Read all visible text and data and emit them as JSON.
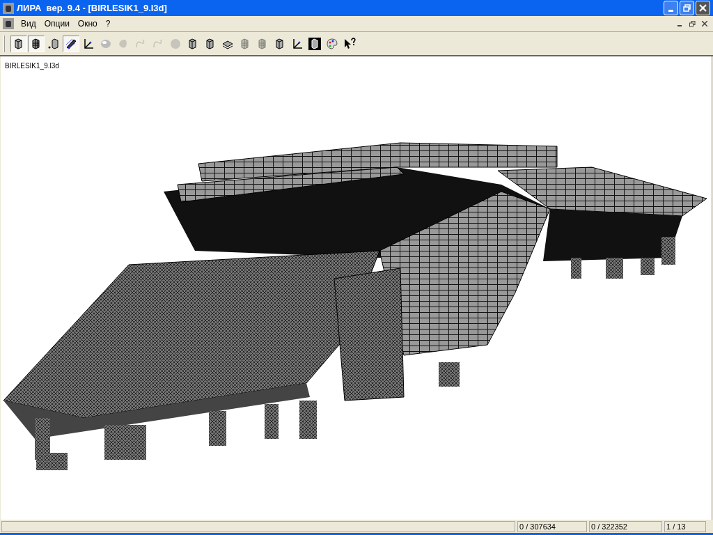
{
  "window": {
    "title": "ЛИРА  вер. 9.4 - [BIRLESIK1_9.l3d]"
  },
  "menu": [
    "Вид",
    "Опции",
    "Окно",
    "?"
  ],
  "toolbar": [
    {
      "kind": "cube",
      "pressed": true,
      "disabled": false
    },
    {
      "kind": "mesh",
      "pressed": true,
      "disabled": false
    },
    {
      "kind": "nodes",
      "pressed": false,
      "disabled": false
    },
    {
      "kind": "beam",
      "pressed": true,
      "disabled": false
    },
    {
      "kind": "axes",
      "pressed": false,
      "disabled": false
    },
    {
      "kind": "sphere",
      "pressed": false,
      "disabled": false
    },
    {
      "kind": "blob",
      "pressed": false,
      "disabled": true
    },
    {
      "kind": "curve",
      "pressed": false,
      "disabled": true
    },
    {
      "kind": "curve",
      "pressed": false,
      "disabled": true
    },
    {
      "kind": "disc",
      "pressed": false,
      "disabled": true
    },
    {
      "kind": "cube",
      "pressed": false,
      "disabled": false
    },
    {
      "kind": "cube",
      "pressed": false,
      "disabled": false
    },
    {
      "kind": "layers",
      "pressed": false,
      "disabled": false
    },
    {
      "kind": "mesh",
      "pressed": false,
      "disabled": true
    },
    {
      "kind": "mesh",
      "pressed": false,
      "disabled": true
    },
    {
      "kind": "cube",
      "pressed": false,
      "disabled": false
    },
    {
      "kind": "axes",
      "pressed": false,
      "disabled": false
    },
    {
      "kind": "solid",
      "pressed": false,
      "disabled": false
    },
    {
      "kind": "palette",
      "pressed": false,
      "disabled": false
    },
    {
      "kind": "help",
      "pressed": false,
      "disabled": false
    }
  ],
  "document": {
    "title": "BIRLESIK1_9.l3d"
  },
  "status_bar": [
    "0 / 307634",
    "0 / 322352",
    "1 / 13"
  ]
}
